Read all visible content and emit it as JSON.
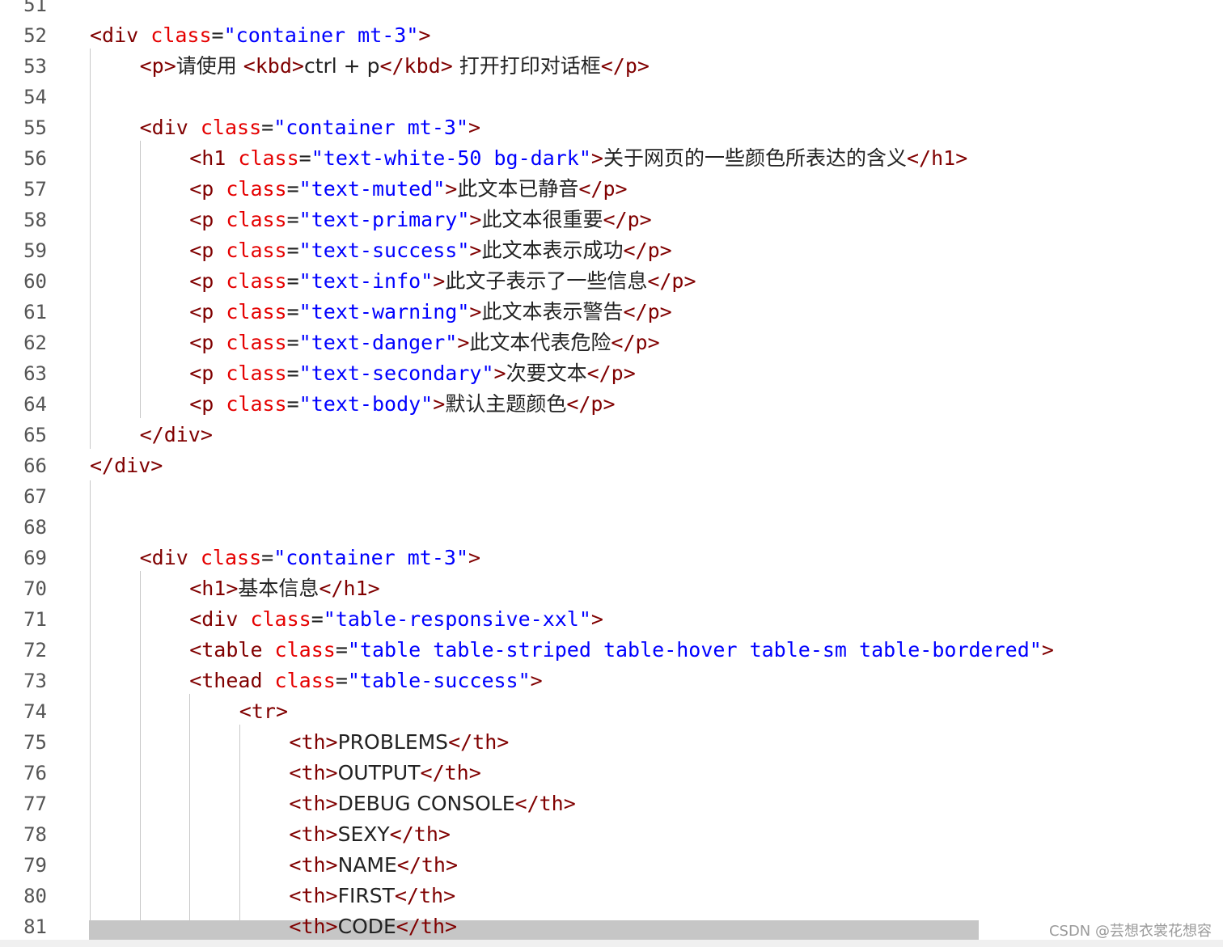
{
  "lines": [
    {
      "number": "51",
      "indent": 0,
      "tokens": []
    },
    {
      "number": "52",
      "indent": 1,
      "tokens": [
        {
          "t": "tag",
          "v": "<div "
        },
        {
          "t": "attr",
          "v": "class"
        },
        {
          "t": "eq",
          "v": "="
        },
        {
          "t": "str",
          "v": "\"container mt-3\""
        },
        {
          "t": "tag",
          "v": ">"
        }
      ]
    },
    {
      "number": "53",
      "indent": 2,
      "tokens": [
        {
          "t": "tag",
          "v": "<p>"
        },
        {
          "t": "text",
          "v": "请使用 "
        },
        {
          "t": "tag",
          "v": "<kbd>"
        },
        {
          "t": "text",
          "v": "ctrl + p"
        },
        {
          "t": "tag",
          "v": "</kbd>"
        },
        {
          "t": "text",
          "v": " 打开打印对话框"
        },
        {
          "t": "tag",
          "v": "</p>"
        }
      ]
    },
    {
      "number": "54",
      "indent": 0,
      "tokens": []
    },
    {
      "number": "55",
      "indent": 2,
      "tokens": [
        {
          "t": "tag",
          "v": "<div "
        },
        {
          "t": "attr",
          "v": "class"
        },
        {
          "t": "eq",
          "v": "="
        },
        {
          "t": "str",
          "v": "\"container mt-3\""
        },
        {
          "t": "tag",
          "v": ">"
        }
      ]
    },
    {
      "number": "56",
      "indent": 3,
      "tokens": [
        {
          "t": "tag",
          "v": "<h1 "
        },
        {
          "t": "attr",
          "v": "class"
        },
        {
          "t": "eq",
          "v": "="
        },
        {
          "t": "str",
          "v": "\"text-white-50 bg-dark\""
        },
        {
          "t": "tag",
          "v": ">"
        },
        {
          "t": "text",
          "v": "关于网页的一些颜色所表达的含义"
        },
        {
          "t": "tag",
          "v": "</h1>"
        }
      ]
    },
    {
      "number": "57",
      "indent": 3,
      "tokens": [
        {
          "t": "tag",
          "v": "<p "
        },
        {
          "t": "attr",
          "v": "class"
        },
        {
          "t": "eq",
          "v": "="
        },
        {
          "t": "str",
          "v": "\"text-muted\""
        },
        {
          "t": "tag",
          "v": ">"
        },
        {
          "t": "text",
          "v": "此文本已静音"
        },
        {
          "t": "tag",
          "v": "</p>"
        }
      ]
    },
    {
      "number": "58",
      "indent": 3,
      "tokens": [
        {
          "t": "tag",
          "v": "<p "
        },
        {
          "t": "attr",
          "v": "class"
        },
        {
          "t": "eq",
          "v": "="
        },
        {
          "t": "str",
          "v": "\"text-primary\""
        },
        {
          "t": "tag",
          "v": ">"
        },
        {
          "t": "text",
          "v": "此文本很重要"
        },
        {
          "t": "tag",
          "v": "</p>"
        }
      ]
    },
    {
      "number": "59",
      "indent": 3,
      "tokens": [
        {
          "t": "tag",
          "v": "<p "
        },
        {
          "t": "attr",
          "v": "class"
        },
        {
          "t": "eq",
          "v": "="
        },
        {
          "t": "str",
          "v": "\"text-success\""
        },
        {
          "t": "tag",
          "v": ">"
        },
        {
          "t": "text",
          "v": "此文本表示成功"
        },
        {
          "t": "tag",
          "v": "</p>"
        }
      ]
    },
    {
      "number": "60",
      "indent": 3,
      "tokens": [
        {
          "t": "tag",
          "v": "<p "
        },
        {
          "t": "attr",
          "v": "class"
        },
        {
          "t": "eq",
          "v": "="
        },
        {
          "t": "str",
          "v": "\"text-info\""
        },
        {
          "t": "tag",
          "v": ">"
        },
        {
          "t": "text",
          "v": "此文子表示了一些信息"
        },
        {
          "t": "tag",
          "v": "</p>"
        }
      ]
    },
    {
      "number": "61",
      "indent": 3,
      "tokens": [
        {
          "t": "tag",
          "v": "<p "
        },
        {
          "t": "attr",
          "v": "class"
        },
        {
          "t": "eq",
          "v": "="
        },
        {
          "t": "str",
          "v": "\"text-warning\""
        },
        {
          "t": "tag",
          "v": ">"
        },
        {
          "t": "text",
          "v": "此文本表示警告"
        },
        {
          "t": "tag",
          "v": "</p>"
        }
      ]
    },
    {
      "number": "62",
      "indent": 3,
      "tokens": [
        {
          "t": "tag",
          "v": "<p "
        },
        {
          "t": "attr",
          "v": "class"
        },
        {
          "t": "eq",
          "v": "="
        },
        {
          "t": "str",
          "v": "\"text-danger\""
        },
        {
          "t": "tag",
          "v": ">"
        },
        {
          "t": "text",
          "v": "此文本代表危险"
        },
        {
          "t": "tag",
          "v": "</p>"
        }
      ]
    },
    {
      "number": "63",
      "indent": 3,
      "tokens": [
        {
          "t": "tag",
          "v": "<p "
        },
        {
          "t": "attr",
          "v": "class"
        },
        {
          "t": "eq",
          "v": "="
        },
        {
          "t": "str",
          "v": "\"text-secondary\""
        },
        {
          "t": "tag",
          "v": ">"
        },
        {
          "t": "text",
          "v": "次要文本"
        },
        {
          "t": "tag",
          "v": "</p>"
        }
      ]
    },
    {
      "number": "64",
      "indent": 3,
      "tokens": [
        {
          "t": "tag",
          "v": "<p "
        },
        {
          "t": "attr",
          "v": "class"
        },
        {
          "t": "eq",
          "v": "="
        },
        {
          "t": "str",
          "v": "\"text-body\""
        },
        {
          "t": "tag",
          "v": ">"
        },
        {
          "t": "text",
          "v": "默认主题颜色"
        },
        {
          "t": "tag",
          "v": "</p>"
        }
      ]
    },
    {
      "number": "65",
      "indent": 2,
      "tokens": [
        {
          "t": "tag",
          "v": "</div>"
        }
      ]
    },
    {
      "number": "66",
      "indent": 1,
      "tokens": [
        {
          "t": "tag",
          "v": "</div>"
        }
      ]
    },
    {
      "number": "67",
      "indent": 0,
      "tokens": []
    },
    {
      "number": "68",
      "indent": 0,
      "tokens": []
    },
    {
      "number": "69",
      "indent": 2,
      "tokens": [
        {
          "t": "tag",
          "v": "<div "
        },
        {
          "t": "attr",
          "v": "class"
        },
        {
          "t": "eq",
          "v": "="
        },
        {
          "t": "str",
          "v": "\"container mt-3\""
        },
        {
          "t": "tag",
          "v": ">"
        }
      ]
    },
    {
      "number": "70",
      "indent": 3,
      "tokens": [
        {
          "t": "tag",
          "v": "<h1>"
        },
        {
          "t": "text",
          "v": "基本信息"
        },
        {
          "t": "tag",
          "v": "</h1>"
        }
      ]
    },
    {
      "number": "71",
      "indent": 3,
      "tokens": [
        {
          "t": "tag",
          "v": "<div "
        },
        {
          "t": "attr",
          "v": "class"
        },
        {
          "t": "eq",
          "v": "="
        },
        {
          "t": "str",
          "v": "\"table-responsive-xxl\""
        },
        {
          "t": "tag",
          "v": ">"
        }
      ]
    },
    {
      "number": "72",
      "indent": 3,
      "tokens": [
        {
          "t": "tag",
          "v": "<table "
        },
        {
          "t": "attr",
          "v": "class"
        },
        {
          "t": "eq",
          "v": "="
        },
        {
          "t": "str",
          "v": "\"table table-striped table-hover table-sm table-bordered\""
        },
        {
          "t": "tag",
          "v": ">"
        }
      ]
    },
    {
      "number": "73",
      "indent": 3,
      "tokens": [
        {
          "t": "tag",
          "v": "<thead "
        },
        {
          "t": "attr",
          "v": "class"
        },
        {
          "t": "eq",
          "v": "="
        },
        {
          "t": "str",
          "v": "\"table-success\""
        },
        {
          "t": "tag",
          "v": ">"
        }
      ]
    },
    {
      "number": "74",
      "indent": 4,
      "tokens": [
        {
          "t": "tag",
          "v": "<tr>"
        }
      ]
    },
    {
      "number": "75",
      "indent": 5,
      "tokens": [
        {
          "t": "tag",
          "v": "<th>"
        },
        {
          "t": "text",
          "v": "PROBLEMS"
        },
        {
          "t": "tag",
          "v": "</th>"
        }
      ]
    },
    {
      "number": "76",
      "indent": 5,
      "tokens": [
        {
          "t": "tag",
          "v": "<th>"
        },
        {
          "t": "text",
          "v": "OUTPUT"
        },
        {
          "t": "tag",
          "v": "</th>"
        }
      ]
    },
    {
      "number": "77",
      "indent": 5,
      "tokens": [
        {
          "t": "tag",
          "v": "<th>"
        },
        {
          "t": "text",
          "v": "DEBUG CONSOLE"
        },
        {
          "t": "tag",
          "v": "</th>"
        }
      ]
    },
    {
      "number": "78",
      "indent": 5,
      "tokens": [
        {
          "t": "tag",
          "v": "<th>"
        },
        {
          "t": "text",
          "v": "SEXY"
        },
        {
          "t": "tag",
          "v": "</th>"
        }
      ]
    },
    {
      "number": "79",
      "indent": 5,
      "tokens": [
        {
          "t": "tag",
          "v": "<th>"
        },
        {
          "t": "text",
          "v": "NAME"
        },
        {
          "t": "tag",
          "v": "</th>"
        }
      ]
    },
    {
      "number": "80",
      "indent": 5,
      "tokens": [
        {
          "t": "tag",
          "v": "<th>"
        },
        {
          "t": "text",
          "v": "FIRST"
        },
        {
          "t": "tag",
          "v": "</th>"
        }
      ]
    },
    {
      "number": "81",
      "indent": 5,
      "tokens": [
        {
          "t": "tag",
          "v": "<th>"
        },
        {
          "t": "text",
          "v": "CODE"
        },
        {
          "t": "tag",
          "v": "</th>"
        }
      ]
    }
  ],
  "watermark": "CSDN @芸想衣裳花想容",
  "colors": {
    "tag": "#800000",
    "attr": "#e50000",
    "string": "#0000ff",
    "text": "#222222",
    "line_number": "#555555",
    "indent_guide": "#c8c8c8",
    "current_line_highlight": "#c6c6c6"
  }
}
